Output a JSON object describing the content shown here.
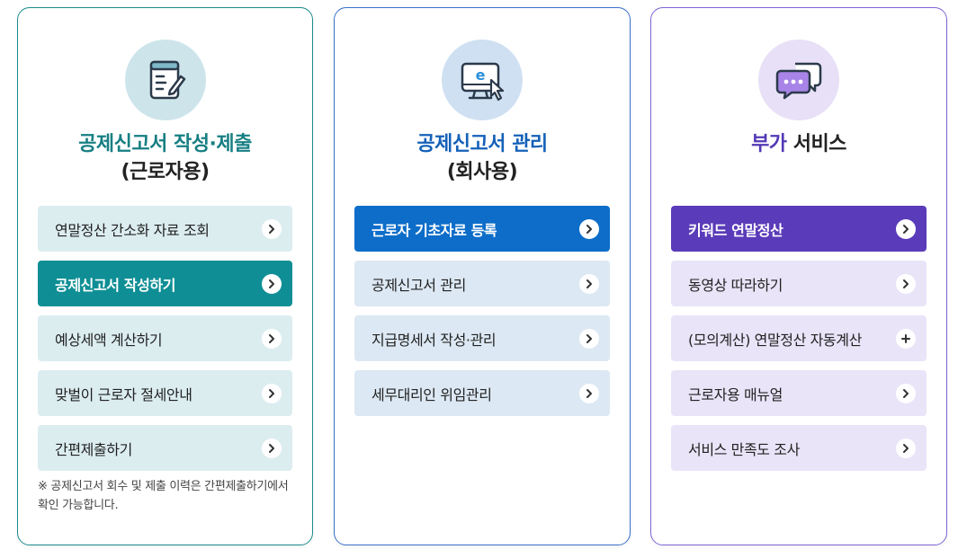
{
  "cards": [
    {
      "title_main": "공제신고서 작성·제출",
      "title_sub": "(근로자용)",
      "icon": "document-pen-icon",
      "accent": "#0f8f95",
      "items": [
        {
          "label": "연말정산 간소화 자료 조회",
          "icon": "chevron-right-icon"
        },
        {
          "label": "공제신고서 작성하기",
          "icon": "chevron-right-icon",
          "active": true
        },
        {
          "label": "예상세액 계산하기",
          "icon": "chevron-right-icon"
        },
        {
          "label": "맞벌이 근로자 절세안내",
          "icon": "chevron-right-icon"
        },
        {
          "label": "간편제출하기",
          "icon": "chevron-right-icon"
        }
      ],
      "note": "※ 공제신고서 회수 및 제출 이력은 간편제출하기에서 확인 가능합니다."
    },
    {
      "title_main": "공제신고서 관리",
      "title_sub": "(회사용)",
      "icon": "monitor-e-cursor-icon",
      "accent": "#0d6dc9",
      "items": [
        {
          "label": "근로자 기초자료 등록",
          "icon": "chevron-right-icon",
          "active": true
        },
        {
          "label": "공제신고서 관리",
          "icon": "chevron-right-icon"
        },
        {
          "label": "지급명세서 작성·관리",
          "icon": "chevron-right-icon"
        },
        {
          "label": "세무대리인 위임관리",
          "icon": "chevron-right-icon"
        }
      ]
    },
    {
      "title_main": "부가",
      "title_rest": " 서비스",
      "icon": "chat-bubbles-icon",
      "accent": "#5a3bb9",
      "items": [
        {
          "label": "키워드 연말정산",
          "icon": "chevron-right-icon",
          "active": true
        },
        {
          "label": "동영상 따라하기",
          "icon": "chevron-right-icon"
        },
        {
          "label": "(모의계산) 연말정산 자동계산",
          "icon": "plus-icon"
        },
        {
          "label": "근로자용 매뉴얼",
          "icon": "chevron-right-icon"
        },
        {
          "label": "서비스 만족도 조사",
          "icon": "chevron-right-icon"
        }
      ]
    }
  ]
}
